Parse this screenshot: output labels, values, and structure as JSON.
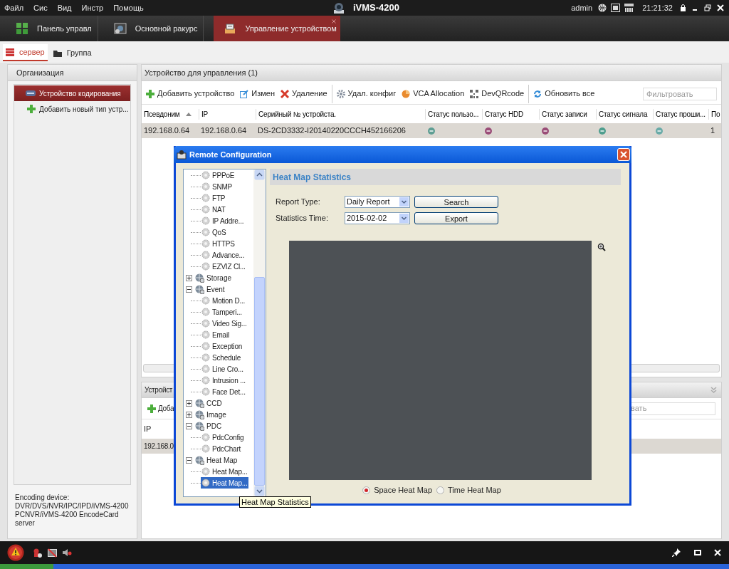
{
  "menu": [
    "Файл",
    "Сис",
    "Вид",
    "Инстр",
    "Помощь"
  ],
  "app_title": "iVMS-4200",
  "user": "admin",
  "clock": "21:21:32",
  "tabs": [
    {
      "label": "Панель управл",
      "selected": false,
      "kind": "panel"
    },
    {
      "label": "Основной ракурс",
      "selected": false,
      "kind": "view"
    },
    {
      "label": "Управление устройством",
      "selected": true,
      "kind": "device"
    }
  ],
  "subtabs": [
    {
      "label": "сервер",
      "selected": true,
      "kind": "server"
    },
    {
      "label": "Группа",
      "selected": false,
      "kind": "group"
    }
  ],
  "organization": {
    "title": "Организация",
    "items": [
      {
        "label": "Устройство кодирования",
        "selected": true,
        "kind": "device"
      },
      {
        "label": "Добавить новый тип устр...",
        "selected": false,
        "kind": "add"
      }
    ],
    "note": "Encoding device: DVR/DVS/NVR/IPC/IPD/iVMS-4200 PCNVR/iVMS-4200 EncodeCard server"
  },
  "devices": {
    "title": "Устройство для управления (1)",
    "toolbar": [
      [
        {
          "label": "Добавить устройство",
          "kind": "add"
        },
        {
          "label": "Измен",
          "kind": "edit"
        },
        {
          "label": "Удаление",
          "kind": "delete"
        }
      ],
      [
        {
          "label": "Удал. конфиг",
          "kind": "config"
        },
        {
          "label": "VCA Allocation",
          "kind": "vca"
        },
        {
          "label": "DevQRcode",
          "kind": "qr"
        }
      ],
      [
        {
          "label": "Обновить все",
          "kind": "refresh"
        }
      ]
    ],
    "filter_placeholder": "Фильтровать",
    "columns": [
      {
        "label": "Псевдоним",
        "sorted": true
      },
      {
        "label": "IP"
      },
      {
        "label": "Серийный № устройста."
      },
      {
        "label": "Статус пользо..."
      },
      {
        "label": "Статус HDD"
      },
      {
        "label": "Статус записи"
      },
      {
        "label": "Статус сигнала"
      },
      {
        "label": "Статус проши..."
      },
      {
        "label": "По"
      }
    ],
    "rows": [
      {
        "selected": true,
        "cells": [
          {
            "kind": "text",
            "text": "192.168.0.64"
          },
          {
            "kind": "text",
            "text": "192.168.0.64"
          },
          {
            "kind": "text",
            "text": "DS-2CD3332-I20140220CCCH452166206"
          },
          {
            "kind": "status",
            "color": "#5f9e93"
          },
          {
            "kind": "status",
            "color": "#9a4d77"
          },
          {
            "kind": "status",
            "color": "#9a4d77"
          },
          {
            "kind": "status",
            "color": "#4f9e8e"
          },
          {
            "kind": "status",
            "color": "#6aaba8"
          },
          {
            "kind": "text",
            "text": "1"
          }
        ]
      }
    ]
  },
  "second_panel": {
    "title": "Устройст",
    "add_button": "Доба",
    "filter_placeholder": "вать",
    "columns": [
      "IP"
    ],
    "rows": [
      {
        "selected": true,
        "cells": [
          "192.168.0."
        ]
      }
    ]
  },
  "dialog": {
    "title": "Remote Configuration",
    "tree": [
      {
        "children": [
          {
            "label": "PPPoE",
            "selected": false
          },
          {
            "label": "SNMP",
            "selected": false
          },
          {
            "label": "FTP",
            "selected": false
          },
          {
            "label": "NAT",
            "selected": false
          },
          {
            "label": "IP Addre...",
            "selected": false
          },
          {
            "label": "QoS",
            "selected": false
          },
          {
            "label": "HTTPS",
            "selected": false
          },
          {
            "label": "Advance...",
            "selected": false
          },
          {
            "label": "EZVIZ Cl...",
            "selected": false
          }
        ]
      },
      {
        "label": "Storage",
        "expanded": false,
        "selected": false
      },
      {
        "label": "Event",
        "expanded": true,
        "selected": false,
        "children": [
          {
            "label": "Motion D...",
            "selected": false
          },
          {
            "label": "Tamperi...",
            "selected": false
          },
          {
            "label": "Video Sig...",
            "selected": false
          },
          {
            "label": "Email",
            "selected": false
          },
          {
            "label": "Exception",
            "selected": false
          },
          {
            "label": "Schedule",
            "selected": false
          },
          {
            "label": "Line Cro...",
            "selected": false
          },
          {
            "label": "Intrusion ...",
            "selected": false
          },
          {
            "label": "Face Det...",
            "selected": false
          }
        ]
      },
      {
        "label": "CCD",
        "expanded": false,
        "selected": false
      },
      {
        "label": "Image",
        "expanded": false,
        "selected": false
      },
      {
        "label": "PDC",
        "expanded": true,
        "selected": false,
        "children": [
          {
            "label": "PdcConfig",
            "selected": false
          },
          {
            "label": "PdcChart",
            "selected": false
          }
        ]
      },
      {
        "label": "Heat Map",
        "expanded": true,
        "selected": false,
        "children": [
          {
            "label": "Heat Map...",
            "selected": false
          },
          {
            "label": "Heat Map...",
            "selected": true
          }
        ]
      }
    ],
    "section_title": "Heat Map Statistics",
    "fields": [
      {
        "label": "Report Type:",
        "value": "Daily Report",
        "button": "Search"
      },
      {
        "label": "Statistics Time:",
        "value": "2015-02-02",
        "button": "Export"
      }
    ],
    "modes": [
      {
        "label": "Space Heat Map",
        "selected": true
      },
      {
        "label": "Time Heat Map",
        "selected": false
      }
    ],
    "tooltip": "Heat Map Statistics"
  }
}
